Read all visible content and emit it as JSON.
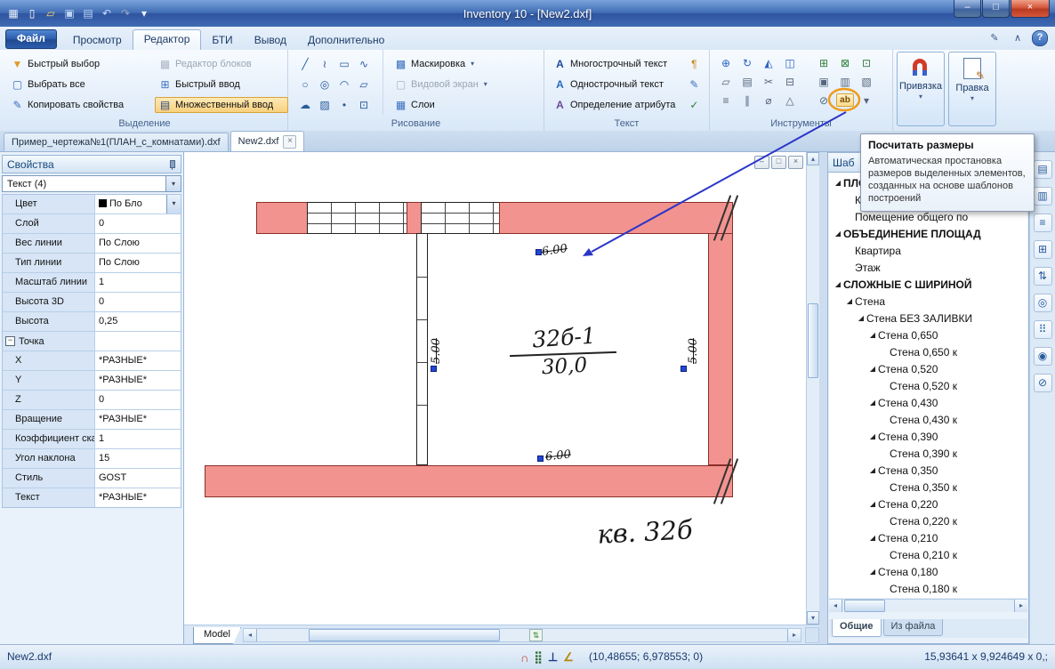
{
  "titlebar": {
    "title": "Inventory 10 - [New2.dxf]"
  },
  "window_buttons": {
    "minimize": "–",
    "maximize": "□",
    "close": "×"
  },
  "qat_icons": [
    {
      "n": "app-icon",
      "g": "▦",
      "c": "#e8f0fb"
    },
    {
      "n": "new-file-icon",
      "g": "▯",
      "c": "#ffffff"
    },
    {
      "n": "open-file-icon",
      "g": "▱",
      "c": "#ffd76e"
    },
    {
      "n": "save-icon",
      "g": "▣",
      "c": "#bcd6f5"
    },
    {
      "n": "save-all-icon",
      "g": "▤",
      "c": "#bcd6f5"
    },
    {
      "n": "undo-icon",
      "g": "↶",
      "c": "#cdd9ff"
    },
    {
      "n": "redo-icon",
      "g": "↷",
      "c": "#93a7c4"
    },
    {
      "n": "qat-dropdown-icon",
      "g": "▾",
      "c": "#e8f0fb"
    }
  ],
  "menu": {
    "tabs": [
      {
        "label": "Файл"
      },
      {
        "label": "Просмотр"
      },
      {
        "label": "Редактор"
      },
      {
        "label": "БТИ"
      },
      {
        "label": "Вывод"
      },
      {
        "label": "Дополнительно"
      }
    ]
  },
  "ribbon_corner": {
    "customize": "✎",
    "collapse": "∧",
    "help": "?"
  },
  "ui": {
    "dropdown_glyph": "▾",
    "expand_glyph": "◢",
    "collapse_glyph": "−",
    "close_glyph": "×"
  },
  "colors": {
    "wall": "#f2938f",
    "highlight_orange": "#f09a18",
    "arrow_blue": "#2b35c8",
    "grip_blue": "#2246d8"
  },
  "ribbon": {
    "selection": {
      "label": "Выделение",
      "buttons": [
        {
          "n": "quick-select-button",
          "label": "Быстрый выбор",
          "g": "▼",
          "c": "#e09b2d"
        },
        {
          "n": "select-all-button",
          "label": "Выбрать все",
          "g": "▢",
          "c": "#3a6fc0"
        },
        {
          "n": "copy-properties-button",
          "label": "Копировать свойства",
          "g": "✎",
          "c": "#3a6fc0"
        },
        {
          "n": "block-editor-button",
          "label": "Редактор блоков",
          "g": "▦",
          "c": "#a8b4c2",
          "disabled": true
        },
        {
          "n": "quick-input-button",
          "label": "Быстрый ввод",
          "g": "⊞",
          "c": "#3a6fc0"
        },
        {
          "n": "multi-input-button",
          "label": "Множественный ввод",
          "g": "▤",
          "c": "#2a4a8a",
          "highlight": true
        }
      ]
    },
    "drawing": {
      "label": "Рисование",
      "grid_icons": [
        {
          "n": "line-icon",
          "g": "╱"
        },
        {
          "n": "polyline-icon",
          "g": "≀"
        },
        {
          "n": "rectangle-icon",
          "g": "▭"
        },
        {
          "n": "spline-icon",
          "g": "∿"
        },
        {
          "n": "circle-icon",
          "g": "○"
        },
        {
          "n": "ellipse-icon",
          "g": "◎"
        },
        {
          "n": "arc-icon",
          "g": "◠"
        },
        {
          "n": "region-icon",
          "g": "▱"
        },
        {
          "n": "revcloud-icon",
          "g": "☁"
        },
        {
          "n": "hatch-icon",
          "g": "▨"
        },
        {
          "n": "point-icon",
          "g": "•"
        },
        {
          "n": "block-icon",
          "g": "⊡"
        }
      ],
      "buttons": [
        {
          "n": "mask-button",
          "label": "Маскировка",
          "g": "▩",
          "c": "#3a6fc0",
          "dropdown": true
        },
        {
          "n": "viewport-button",
          "label": "Видовой экран",
          "g": "▢",
          "c": "#a8b4c2",
          "dropdown": true,
          "disabled": true
        },
        {
          "n": "layers-button",
          "label": "Слои",
          "g": "▦",
          "c": "#3a6fc0"
        }
      ]
    },
    "text": {
      "label": "Текст",
      "buttons": [
        {
          "n": "multiline-text-button",
          "label": "Многострочный текст",
          "g": "A",
          "c": "#1a4a9a"
        },
        {
          "n": "singleline-text-button",
          "label": "Однострочный текст",
          "g": "A",
          "c": "#2a6ac0"
        },
        {
          "n": "attribute-def-button",
          "label": "Определение атрибута",
          "g": "A",
          "c": "#6a4a9a"
        }
      ],
      "side_icons": [
        {
          "n": "field-icon",
          "g": "¶",
          "c": "#c08a1a"
        },
        {
          "n": "edit-text-icon",
          "g": "✎",
          "c": "#3a6fc0"
        },
        {
          "n": "spellcheck-icon",
          "g": "✓",
          "c": "#2f7d3a"
        }
      ]
    },
    "tools": {
      "label": "Инструменты",
      "left_icons": [
        {
          "n": "move-icon",
          "g": "⊕",
          "c": "#2a62c0"
        },
        {
          "n": "rotate-icon",
          "g": "↻",
          "c": "#2a62c0"
        },
        {
          "n": "mirror-icon",
          "g": "◭",
          "c": "#2a62c0"
        },
        {
          "n": "align-icon",
          "g": "◫",
          "c": "#2a62c0"
        },
        {
          "n": "offset-icon",
          "g": "▱",
          "c": "#55657d"
        },
        {
          "n": "array-icon",
          "g": "▤",
          "c": "#55657d"
        },
        {
          "n": "trim-icon",
          "g": "✂",
          "c": "#55657d"
        },
        {
          "n": "extend-icon",
          "g": "⊟",
          "c": "#55657d"
        },
        {
          "n": "pedit-icon",
          "g": "≡",
          "c": "#55657d"
        },
        {
          "n": "parallel-icon",
          "g": "∥",
          "c": "#55657d"
        },
        {
          "n": "diameter-icon",
          "g": "⌀",
          "c": "#55657d"
        },
        {
          "n": "scale-icon",
          "g": "△",
          "c": "#55657d"
        }
      ],
      "right_icons": [
        {
          "n": "copy-to-clipboard-icon",
          "g": "⊞",
          "c": "#2f7d3a"
        },
        {
          "n": "copy-with-point-icon",
          "g": "⊠",
          "c": "#2f7d3a"
        },
        {
          "n": "paste-icon",
          "g": "⊡",
          "c": "#2f7d3a"
        },
        {
          "n": "group-icon",
          "g": "▣",
          "c": "#55657d"
        },
        {
          "n": "ungroup-icon",
          "g": "▥",
          "c": "#55657d"
        },
        {
          "n": "draw-order-icon",
          "g": "▧",
          "c": "#55657d"
        },
        {
          "n": "isolate-icon",
          "g": "⊘",
          "c": "#55657d"
        },
        {
          "n": "calculate-dimensions-button",
          "g": "ab",
          "calc": true
        },
        {
          "n": "tools-more-dropdown",
          "g": "▾",
          "c": "#55657d"
        }
      ]
    },
    "snap": {
      "label": "Привязка"
    },
    "edit": {
      "label": "Правка"
    }
  },
  "doc_tabs": [
    {
      "label": "Пример_чертежа№1(ПЛАН_с_комнатами).dxf"
    },
    {
      "label": "New2.dxf",
      "active": true
    }
  ],
  "tooltip": {
    "title": "Посчитать размеры",
    "body": "Автоматическая простановка размеров выделенных элементов, созданных на основе шаблонов построений"
  },
  "properties": {
    "title": "Свойства",
    "selector": "Текст (4)",
    "rows": [
      {
        "name": "Цвет",
        "value": "По Бло",
        "type": "color"
      },
      {
        "name": "Слой",
        "value": "0"
      },
      {
        "name": "Вес линии",
        "value": "По Слою"
      },
      {
        "name": "Тип линии",
        "value": "По Слою"
      },
      {
        "name": "Масштаб линии",
        "value": "1"
      },
      {
        "name": "Высота 3D",
        "value": "0"
      },
      {
        "name": "Высота",
        "value": "0,25"
      },
      {
        "name": "Точка",
        "value": "",
        "section": true
      },
      {
        "name": "X",
        "value": "*РАЗНЫЕ*"
      },
      {
        "name": "Y",
        "value": "*РАЗНЫЕ*"
      },
      {
        "name": "Z",
        "value": "0"
      },
      {
        "name": "Вращение",
        "value": "*РАЗНЫЕ*"
      },
      {
        "name": "Коэффициент ска",
        "value": "1"
      },
      {
        "name": "Угол наклона",
        "value": "15"
      },
      {
        "name": "Стиль",
        "value": "GOST"
      },
      {
        "name": "Текст",
        "value": "*РАЗНЫЕ*"
      }
    ]
  },
  "canvas": {
    "model_tab": "Model",
    "room_number": "32б-1",
    "room_area": "30,0",
    "apartment": "кв. 32б",
    "dim_top": "6.00",
    "dim_bottom": "6.00",
    "dim_left": "5.00",
    "dim_right": "5.00"
  },
  "templates": {
    "header": "Шаб",
    "tabs": [
      {
        "label": "Общие",
        "active": true
      },
      {
        "label": "Из файла"
      }
    ],
    "items": [
      {
        "label": "ПЛОЩАДНЫЕ ОБЪЕКТЫ",
        "level": 0,
        "bold": true,
        "exp": true
      },
      {
        "label": "Комната",
        "level": 1
      },
      {
        "label": "Помещение общего по",
        "level": 1
      },
      {
        "label": "ОБЪЕДИНЕНИЕ ПЛОЩАД",
        "level": 0,
        "bold": true,
        "exp": true
      },
      {
        "label": "Квартира",
        "level": 1
      },
      {
        "label": "Этаж",
        "level": 1
      },
      {
        "label": "СЛОЖНЫЕ С ШИРИНОЙ",
        "level": 0,
        "bold": true,
        "exp": true
      },
      {
        "label": "Стена",
        "level": 1,
        "exp": true
      },
      {
        "label": "Стена БЕЗ ЗАЛИВКИ",
        "level": 2,
        "exp": true
      },
      {
        "label": "Стена 0,650",
        "level": 3,
        "exp": true
      },
      {
        "label": "Стена 0,650 к",
        "level": 4
      },
      {
        "label": "Стена 0,520",
        "level": 3,
        "exp": true
      },
      {
        "label": "Стена 0,520 к",
        "level": 4
      },
      {
        "label": "Стена 0,430",
        "level": 3,
        "exp": true
      },
      {
        "label": "Стена 0,430 к",
        "level": 4
      },
      {
        "label": "Стена 0,390",
        "level": 3,
        "exp": true
      },
      {
        "label": "Стена 0,390 к",
        "level": 4
      },
      {
        "label": "Стена 0,350",
        "level": 3,
        "exp": true
      },
      {
        "label": "Стена 0,350 к",
        "level": 4
      },
      {
        "label": "Стена 0,220",
        "level": 3,
        "exp": true
      },
      {
        "label": "Стена 0,220 к",
        "level": 4
      },
      {
        "label": "Стена 0,210",
        "level": 3,
        "exp": true
      },
      {
        "label": "Стена 0,210 к",
        "level": 4
      },
      {
        "label": "Стена 0,180",
        "level": 3,
        "exp": true
      },
      {
        "label": "Стена 0,180 к",
        "level": 4
      }
    ]
  },
  "dock_icons": [
    {
      "n": "dock-properties-icon",
      "g": "▤"
    },
    {
      "n": "dock-sheets-icon",
      "g": "▥"
    },
    {
      "n": "dock-list-icon",
      "g": "≡"
    },
    {
      "n": "dock-table-icon",
      "g": "⊞"
    },
    {
      "n": "dock-sort-icon",
      "g": "⇅"
    },
    {
      "n": "dock-target-icon",
      "g": "◎"
    },
    {
      "n": "dock-grid-icon",
      "g": "⠿"
    },
    {
      "n": "dock-circles-icon",
      "g": "◉"
    },
    {
      "n": "dock-disable-icon",
      "g": "⊘"
    }
  ],
  "statusbar": {
    "file": "New2.dxf",
    "coords": "(10,48655; 6,978553; 0)",
    "extents": "15,93641 x 9,924649 x 0,;",
    "icons": [
      {
        "n": "snap-magnet-icon",
        "g": "∩",
        "c": "#c23a28"
      },
      {
        "n": "grid-dots-icon",
        "g": "⣿",
        "c": "#2f6b2f"
      },
      {
        "n": "ortho-icon",
        "g": "⊥",
        "c": "#1a3a8a"
      },
      {
        "n": "protractor-icon",
        "g": "∠",
        "c": "#b8860b"
      }
    ]
  }
}
